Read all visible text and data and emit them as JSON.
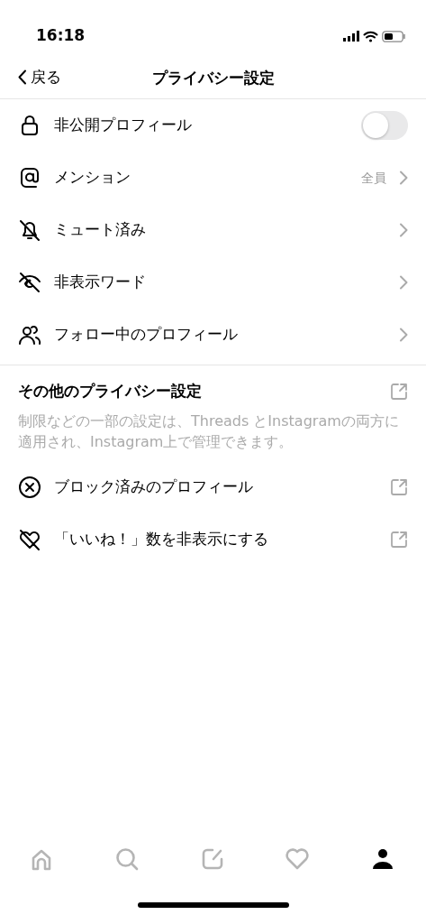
{
  "status_bar": {
    "time": "16:18"
  },
  "nav": {
    "back": "戻る",
    "title": "プライバシー設定"
  },
  "items": [
    {
      "kind": "toggle",
      "label": "非公開プロフィール",
      "on": false
    },
    {
      "kind": "link",
      "label": "メンション",
      "value": "全員"
    },
    {
      "kind": "link",
      "label": "ミュート済み"
    },
    {
      "kind": "link",
      "label": "非表示ワード"
    },
    {
      "kind": "link",
      "label": "フォロー中のプロフィール"
    }
  ],
  "other": {
    "title": "その他のプライバシー設定",
    "description": "制限などの一部の設定は、Threads とInstagramの両方に適用され、Instagram上で管理できます。",
    "items": [
      {
        "kind": "external",
        "label": "ブロック済みのプロフィール"
      },
      {
        "kind": "external",
        "label": "「いいね！」数を非表示にする"
      }
    ]
  },
  "tab_bar": [
    {
      "selected": false
    },
    {
      "selected": false
    },
    {
      "selected": false
    },
    {
      "selected": false
    },
    {
      "selected": true
    }
  ]
}
